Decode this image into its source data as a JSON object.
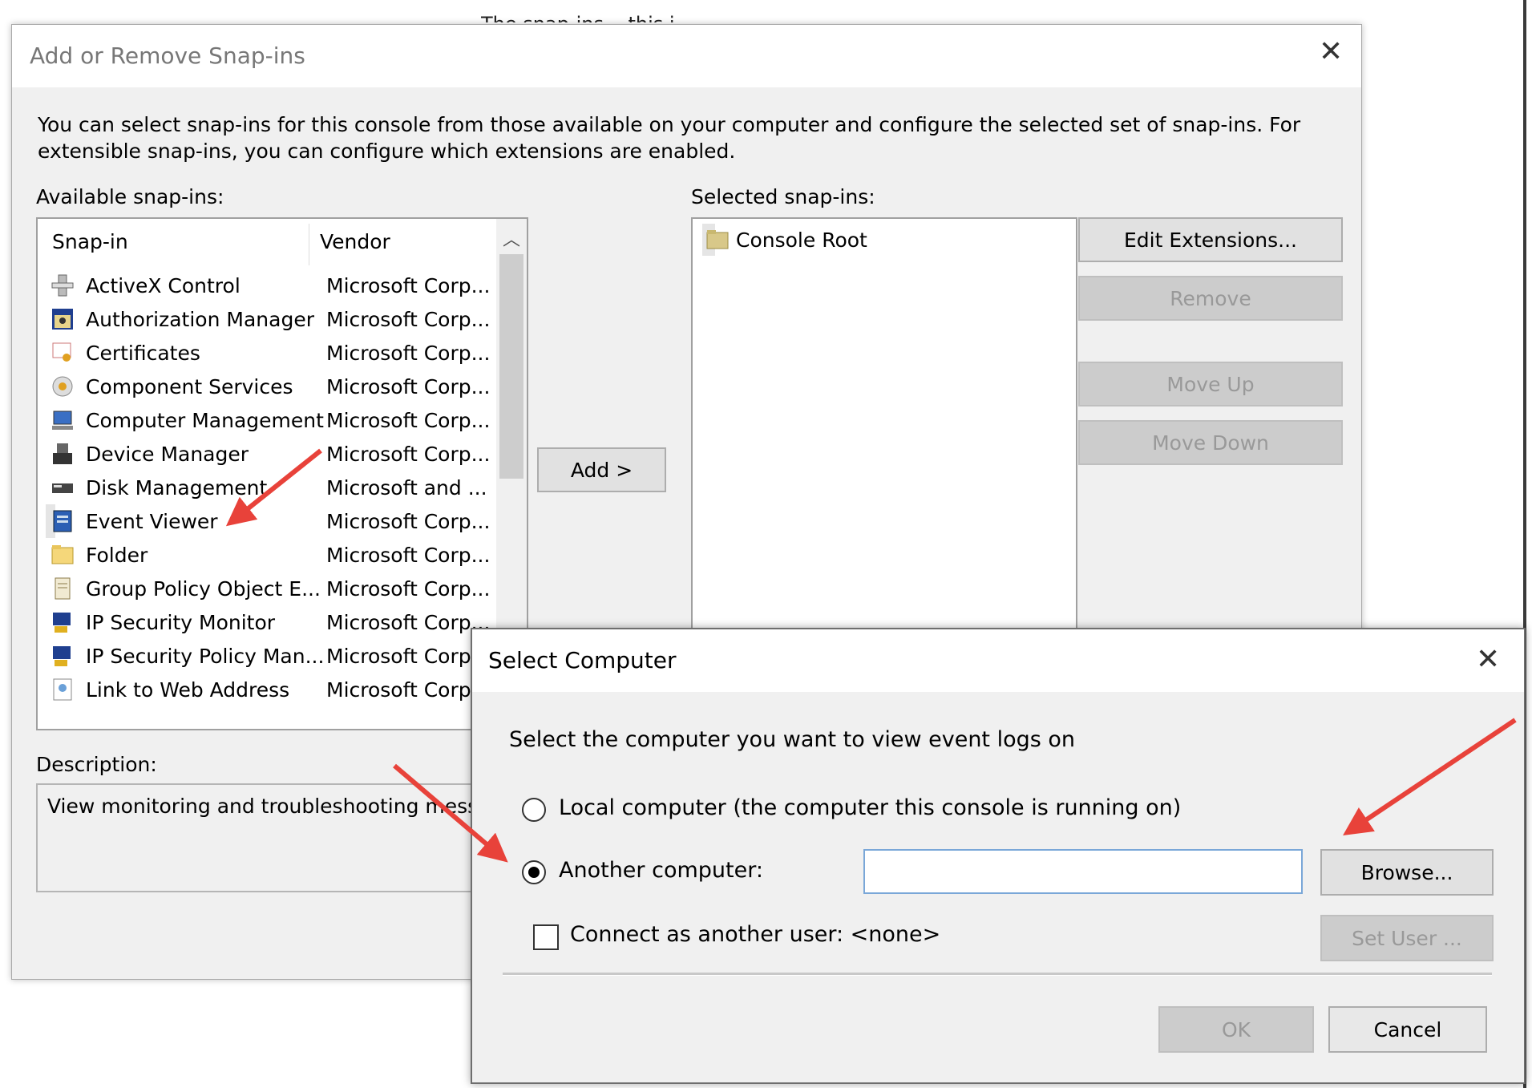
{
  "background_peek_text": "The snap-ins... this i...",
  "main_dialog": {
    "title": "Add or Remove Snap-ins",
    "intro": "You can select snap-ins for this console from those available on your computer and configure the selected set of snap-ins. For extensible snap-ins, you can configure which extensions are enabled.",
    "available_label": "Available snap-ins:",
    "selected_label": "Selected snap-ins:",
    "columns": {
      "snapin": "Snap-in",
      "vendor": "Vendor"
    },
    "snapins": [
      {
        "name": "ActiveX Control",
        "vendor": "Microsoft Corp...",
        "icon": "activex-icon"
      },
      {
        "name": "Authorization Manager",
        "vendor": "Microsoft Corp...",
        "icon": "authorization-manager-icon"
      },
      {
        "name": "Certificates",
        "vendor": "Microsoft Corp...",
        "icon": "certificate-icon"
      },
      {
        "name": "Component Services",
        "vendor": "Microsoft Corp...",
        "icon": "component-services-icon"
      },
      {
        "name": "Computer Management",
        "vendor": "Microsoft Corp...",
        "icon": "computer-management-icon"
      },
      {
        "name": "Device Manager",
        "vendor": "Microsoft Corp...",
        "icon": "device-manager-icon"
      },
      {
        "name": "Disk Management",
        "vendor": "Microsoft and ...",
        "icon": "disk-management-icon"
      },
      {
        "name": "Event Viewer",
        "vendor": "Microsoft Corp...",
        "icon": "event-viewer-icon",
        "highlighted": true
      },
      {
        "name": "Folder",
        "vendor": "Microsoft Corp...",
        "icon": "folder-icon"
      },
      {
        "name": "Group Policy Object E...",
        "vendor": "Microsoft Corp...",
        "icon": "group-policy-icon"
      },
      {
        "name": "IP Security Monitor",
        "vendor": "Microsoft Corp...",
        "icon": "ip-security-monitor-icon"
      },
      {
        "name": "IP Security Policy Man...",
        "vendor": "Microsoft Corp...",
        "icon": "ip-security-policy-icon"
      },
      {
        "name": "Link to Web Address",
        "vendor": "Microsoft Corp...",
        "icon": "web-link-icon"
      }
    ],
    "add_button": "Add >",
    "selected_items": [
      {
        "name": "Console Root",
        "icon": "folder-icon"
      }
    ],
    "buttons": {
      "edit_extensions": "Edit Extensions...",
      "remove": "Remove",
      "move_up": "Move Up",
      "move_down": "Move Down"
    },
    "description_label": "Description:",
    "description_text": "View monitoring and troubleshooting messa"
  },
  "select_computer_dialog": {
    "title": "Select Computer",
    "prompt": "Select the computer you want to view event logs on",
    "option_local": "Local computer (the computer this console is running on)",
    "option_another": "Another computer:",
    "selected_option": "another",
    "computer_name_value": "",
    "browse_button": "Browse...",
    "connect_as_label": "Connect as another user: <none>",
    "connect_as_checked": false,
    "set_user_button": "Set User ...",
    "ok_button": "OK",
    "cancel_button": "Cancel"
  },
  "colors": {
    "dialog_bg": "#f0f0f0",
    "arrow": "#e8423a",
    "disabled_text": "#999999"
  }
}
